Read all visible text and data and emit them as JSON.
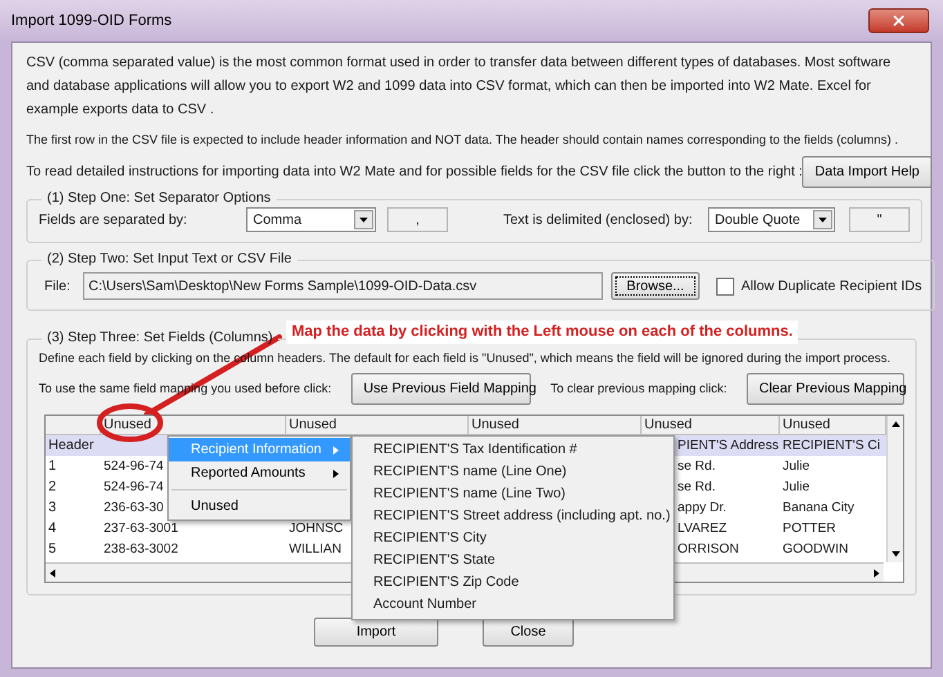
{
  "window": {
    "title": "Import 1099-OID Forms"
  },
  "intro": [
    "CSV (comma separated value) is the most common format used in order to transfer data between different types of databases.  Most software and database applications will allow you to export W2 and 1099 data into CSV format, which can then be imported into W2 Mate. Excel for example exports data to CSV .",
    "The first row in the CSV file is expected to include header information and NOT data. The header should contain names corresponding to the fields (columns) ."
  ],
  "help_row": {
    "text": "To read detailed instructions for importing data into W2 Mate and for possible fields for the CSV file click the button to the right :",
    "button": "Data Import Help"
  },
  "step_one": {
    "legend": "(1)  Step One: Set Separator Options",
    "fields_label": "Fields are separated by:",
    "fields_select": "Comma",
    "fields_char": ",",
    "text_label": "Text is delimited (enclosed) by:",
    "text_select": "Double Quote",
    "text_char": "\""
  },
  "step_two": {
    "legend": "(2)  Step Two: Set Input Text or CSV File",
    "file_label": "File:",
    "file_value": "C:\\Users\\Sam\\Desktop\\New Forms Sample\\1099-OID-Data.csv",
    "browse_button": "Browse...",
    "allow_duplicates": {
      "label": "Allow Duplicate Recipient IDs",
      "checked": false
    }
  },
  "step_three": {
    "legend": "(3)  Step Three: Set Fields (Columns)",
    "annotation": "Map the data by clicking with the Left mouse on each of the columns.",
    "description": "Define each field by clicking on the column headers. The default for each field is \"Unused\", which means the field will be ignored during the import process.",
    "previous_label": "To use the same field mapping you used before click:",
    "previous_button": "Use Previous Field Mapping",
    "clear_label": "To clear previous mapping click:",
    "clear_button": "Clear Previous Mapping",
    "grid": {
      "columns": [
        "Unused",
        "Unused",
        "Unused",
        "Unused",
        "Unused"
      ],
      "rows": [
        {
          "label": "Header",
          "selected": true,
          "cells": [
            null,
            null,
            null,
            "PIENT'S Address",
            "RECIPIENT'S Ci"
          ]
        },
        {
          "label": "1",
          "selected": false,
          "cells": [
            "524-96-74",
            null,
            null,
            "se Rd.",
            "Julie"
          ]
        },
        {
          "label": "2",
          "selected": false,
          "cells": [
            "524-96-74",
            null,
            null,
            "se Rd.",
            "Julie"
          ]
        },
        {
          "label": "3",
          "selected": false,
          "cells": [
            "236-63-30",
            null,
            null,
            "appy Dr.",
            "Banana City"
          ]
        },
        {
          "label": "4",
          "selected": false,
          "cells": [
            "237-63-3001",
            "JOHNSC",
            null,
            "LVAREZ",
            "POTTER"
          ]
        },
        {
          "label": "5",
          "selected": false,
          "cells": [
            "238-63-3002",
            "WILLIAN",
            null,
            "ORRISON",
            "GOODWIN"
          ]
        }
      ]
    }
  },
  "context_menu": {
    "items": [
      {
        "label": "Recipient Information",
        "kind": "submenu",
        "selected": true
      },
      {
        "label": "Reported Amounts",
        "kind": "submenu",
        "selected": false
      },
      {
        "label": "Unused",
        "kind": "item",
        "selected": false
      }
    ]
  },
  "submenu": {
    "items": [
      "RECIPIENT'S Tax Identification #",
      "RECIPIENT'S name (Line One)",
      "RECIPIENT'S name (Line Two)",
      "RECIPIENT'S Street address (including apt. no.)",
      "RECIPIENT'S City",
      "RECIPIENT'S State",
      "RECIPIENT'S Zip Code",
      "Account Number"
    ]
  },
  "buttons": [
    "Import",
    "Close"
  ]
}
